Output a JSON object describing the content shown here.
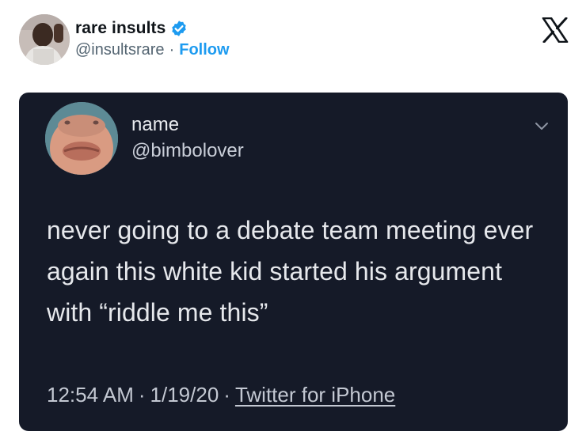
{
  "author": {
    "display_name": "rare insults",
    "handle": "@insultsrare",
    "separator": "·",
    "follow_label": "Follow"
  },
  "embedded_tweet": {
    "name": "name",
    "handle": "@bimbolover",
    "text": "never going to a debate team meeting ever again this white kid started his argument with “riddle me this”",
    "time": "12:54 AM",
    "date": "1/19/20",
    "separator": "·",
    "source": "Twitter for iPhone"
  },
  "colors": {
    "accent": "#1d9bf0",
    "dark_bg": "#151a28",
    "text_primary": "#0f1419",
    "text_secondary": "#536471"
  },
  "icons": {
    "verified": "verified-badge-icon",
    "x_logo": "x-logo-icon",
    "chevron": "chevron-down-icon"
  }
}
